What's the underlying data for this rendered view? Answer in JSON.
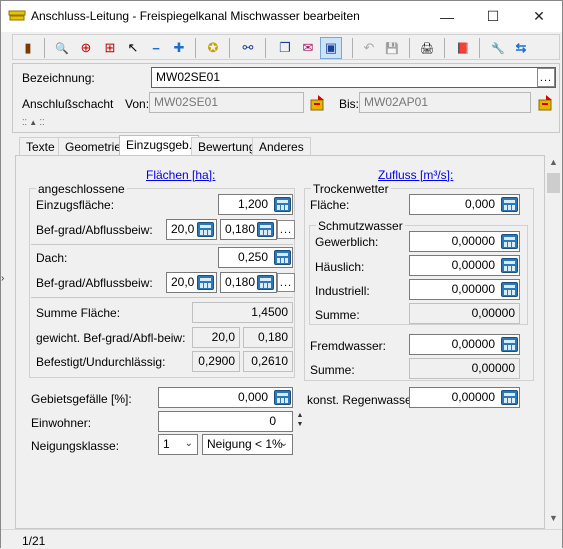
{
  "window": {
    "title": "Anschluss-Leitung - Freispiegelkanal Mischwasser bearbeiten",
    "minimize_glyph": "—",
    "maximize_glyph": "☐",
    "close_glyph": "✕"
  },
  "toolbar": {
    "buttons": [
      {
        "icon": "exit-door-icon",
        "glyph": "▮"
      },
      {
        "icon": "zoom-icon",
        "glyph": "🔍"
      },
      {
        "icon": "zoom-extent-icon",
        "glyph": "⊕"
      },
      {
        "icon": "grid-select-icon",
        "glyph": "⊞"
      },
      {
        "icon": "pointer-icon",
        "glyph": "↖"
      },
      {
        "icon": "minus-icon",
        "glyph": "−"
      },
      {
        "icon": "plus-icon",
        "glyph": "✚"
      },
      {
        "icon": "wizard-icon",
        "glyph": "✪"
      },
      {
        "icon": "network-icon",
        "glyph": "⚯"
      },
      {
        "icon": "copy-window-icon",
        "glyph": "❐"
      },
      {
        "icon": "window-email-icon",
        "glyph": "✉"
      },
      {
        "icon": "window-overlay-icon",
        "glyph": "▣"
      },
      {
        "icon": "undo-icon",
        "glyph": "↶"
      },
      {
        "icon": "save-icon",
        "glyph": "💾"
      },
      {
        "icon": "print-icon",
        "glyph": "🖨"
      },
      {
        "icon": "book-icon",
        "glyph": "📕"
      },
      {
        "icon": "tools-icon",
        "glyph": "🔧"
      },
      {
        "icon": "connect-icon",
        "glyph": "⇆"
      }
    ]
  },
  "header": {
    "bezeichnung_label": "Bezeichnung:",
    "bezeichnung_value": "MW02SE01",
    "anschlussschacht_label": "Anschlußschacht",
    "von_label": "Von:",
    "von_value": "MW02SE01",
    "bis_label": "Bis:",
    "bis_value": "MW02AP01",
    "dots": "..."
  },
  "tabs": [
    "Texte",
    "Geometrie",
    "Einzugsgeb.",
    "Bewertung",
    "Anderes"
  ],
  "active_tab": "Einzugsgeb.",
  "flaechen": {
    "link": "Flächen [ha]:",
    "group_title": "angeschlossene",
    "einzugsflaeche_label": "Einzugsfläche:",
    "einzugsflaeche_value": "1,200",
    "befgrad1_label": "Bef-grad/Abflussbeiw:",
    "befgrad1_value": "20,0",
    "abfluss1_value": "0,180",
    "dach_label": "Dach:",
    "dach_value": "0,250",
    "befgrad2_label": "Bef-grad/Abflussbeiw:",
    "befgrad2_value": "20,0",
    "abfluss2_value": "0,180",
    "summe_label": "Summe Fläche:",
    "summe_value": "1,4500",
    "gewicht_label": "gewicht. Bef-grad/Abfl-beiw:",
    "gewicht_grad": "20,0",
    "gewicht_beiw": "0,180",
    "befestigt_label": "Befestigt/Undurchlässig:",
    "befestigt_value": "0,2900",
    "undurch_value": "0,2610"
  },
  "gebiet": {
    "gefaelle_label": "Gebietsgefälle [%]:",
    "gefaelle_value": "0,000",
    "einwohner_label": "Einwohner:",
    "einwohner_value": "0",
    "neigung_label": "Neigungsklasse:",
    "neigung_value": "1",
    "neigung_text": "Neigung < 1%"
  },
  "zufluss": {
    "link": "Zufluss [m³/s]:",
    "trocken_title": "Trockenwetter",
    "flaeche_label": "Fläche:",
    "flaeche_value": "0,000",
    "schmutz_title": "Schmutzwasser",
    "gewerb_label": "Gewerblich:",
    "gewerb_value": "0,00000",
    "haeusl_label": "Häuslich:",
    "haeusl_value": "0,00000",
    "indust_label": "Industriell:",
    "indust_value": "0,00000",
    "summe1_label": "Summe:",
    "summe1_value": "0,00000",
    "fremd_label": "Fremdwasser:",
    "fremd_value": "0,00000",
    "summe2_label": "Summe:",
    "summe2_value": "0,00000",
    "regen_label": "konst. Regenwasser:",
    "regen_value": "0,00000"
  },
  "status": {
    "record": "1/21"
  }
}
